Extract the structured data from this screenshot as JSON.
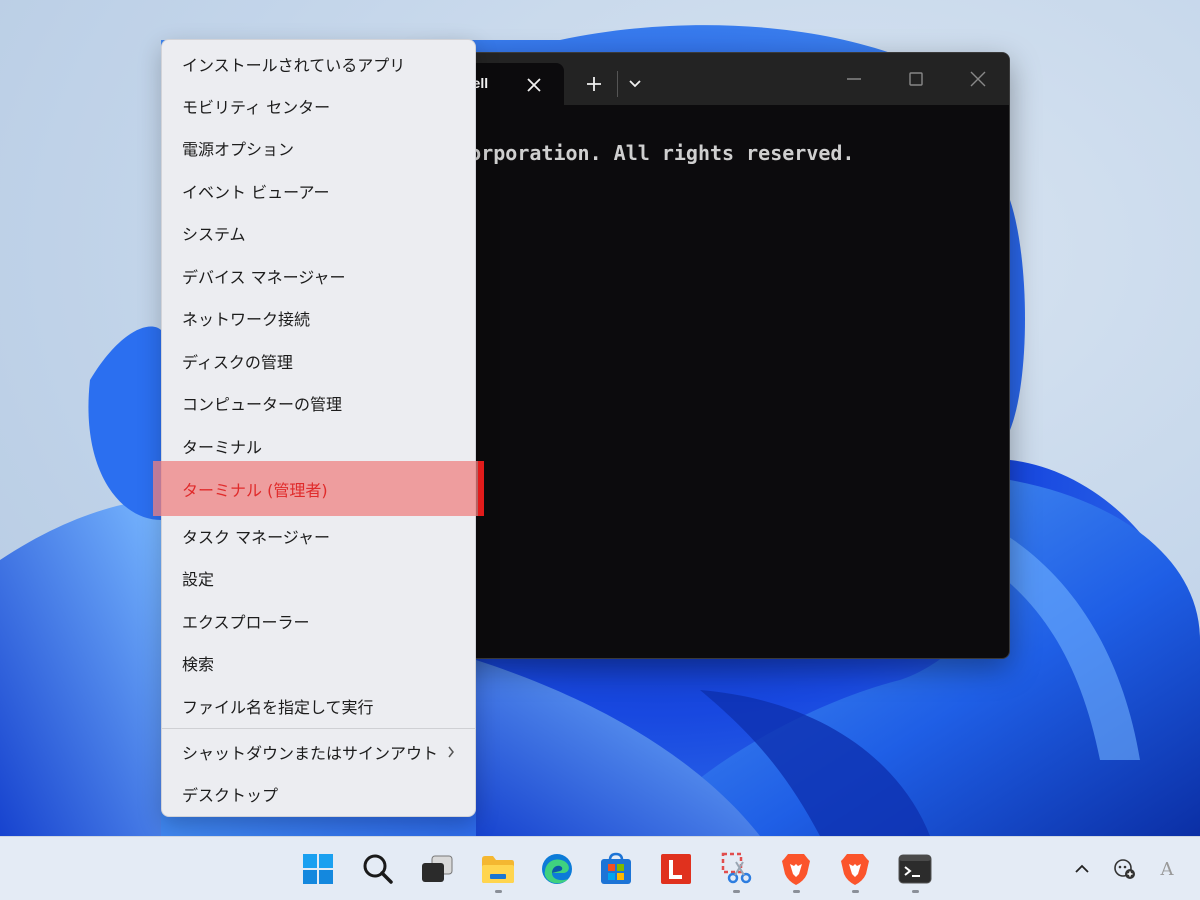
{
  "terminal": {
    "tab_title": "hell",
    "output_text": "ft Corporation. All rights reserved.",
    "background_color": "#0c0b0d"
  },
  "context_menu": {
    "items": [
      {
        "label": "インストールされているアプリ"
      },
      {
        "label": "モビリティ センター"
      },
      {
        "label": "電源オプション"
      },
      {
        "label": "イベント ビューアー"
      },
      {
        "label": "システム"
      },
      {
        "label": "デバイス マネージャー"
      },
      {
        "label": "ネットワーク接続"
      },
      {
        "label": "ディスクの管理"
      },
      {
        "label": "コンピューターの管理"
      },
      {
        "label": "ターミナル"
      },
      {
        "label": "ターミナル (管理者)",
        "highlighted": true
      },
      {
        "label": "タスク マネージャー"
      },
      {
        "label": "設定"
      },
      {
        "label": "エクスプローラー"
      },
      {
        "label": "検索"
      },
      {
        "label": "ファイル名を指定して実行"
      },
      {
        "label": "シャットダウンまたはサインアウト",
        "has_submenu": true
      },
      {
        "label": "デスクトップ"
      }
    ],
    "highlight_color": "#e21b1b"
  },
  "taskbar": {
    "apps": [
      {
        "icon": "windows-start-icon",
        "running": false
      },
      {
        "icon": "search-icon",
        "running": false
      },
      {
        "icon": "task-view-icon",
        "running": false
      },
      {
        "icon": "file-explorer-icon",
        "running": true
      },
      {
        "icon": "edge-browser-icon",
        "running": false
      },
      {
        "icon": "microsoft-store-icon",
        "running": false
      },
      {
        "icon": "red-l-app-icon",
        "running": false
      },
      {
        "icon": "snipping-tool-icon",
        "running": true
      },
      {
        "icon": "brave-browser-icon",
        "running": true
      },
      {
        "icon": "brave-browser-icon",
        "running": true
      },
      {
        "icon": "terminal-icon",
        "running": true
      }
    ],
    "tray": {
      "overflow_icon": "chevron-up-icon",
      "widget_icon": "copilot-icon",
      "ime_label": "A"
    }
  }
}
